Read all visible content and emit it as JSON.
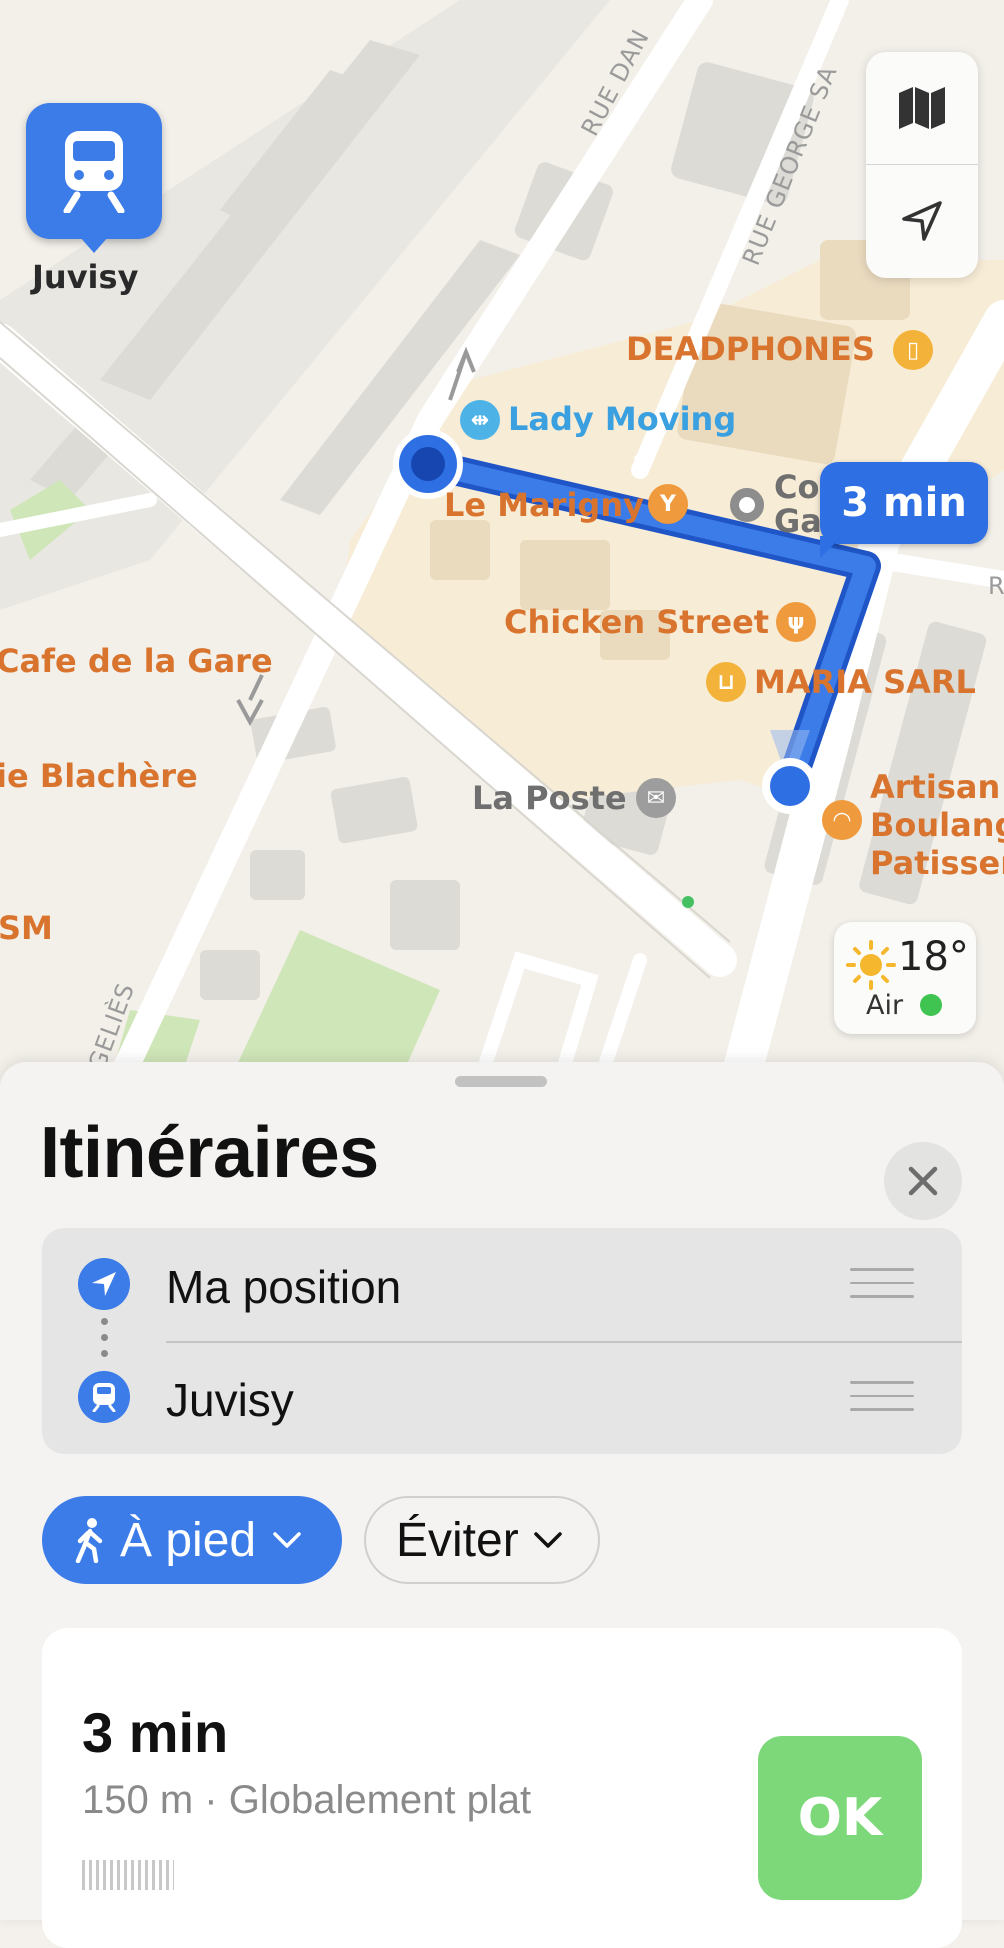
{
  "map": {
    "station": {
      "name": "Juvisy"
    },
    "route_time": "3 min",
    "streets": [
      "RUE DAN",
      "RUE GEORGE SA",
      "GELIÈS",
      "R"
    ],
    "pois": [
      {
        "name": "DEADPHONES",
        "icon": "phone-icon"
      },
      {
        "name": "Lady Moving",
        "icon": "dumbbell-icon"
      },
      {
        "name": "Le Marigny",
        "icon": "cocktail-icon"
      },
      {
        "name": "Co",
        "name2": "Ga",
        "icon": "circle-icon"
      },
      {
        "name": "Chicken Street",
        "icon": "fork-knife-icon"
      },
      {
        "name": "MARIA SARL",
        "icon": "cart-icon"
      },
      {
        "name": "La Poste",
        "icon": "envelope-icon"
      },
      {
        "name": "Artisan",
        "name2": "Boulang",
        "name3": "Patisser",
        "icon": "croissant-icon"
      },
      {
        "name": "Cafe de la Gare"
      },
      {
        "name": "ie Blachère"
      },
      {
        "name": "SM"
      }
    ],
    "weather": {
      "temp": "18°",
      "air_label": "Air",
      "icon": "sun-icon",
      "air_color": "#3fc351"
    },
    "controls": [
      "map-mode-icon",
      "location-arrow-icon"
    ]
  },
  "sheet": {
    "title": "Itinéraires",
    "waypoints": [
      {
        "label": "Ma position",
        "icon": "location-arrow-icon"
      },
      {
        "label": "Juvisy",
        "icon": "train-icon"
      }
    ],
    "mode": {
      "label": "À pied",
      "icon": "walking-icon"
    },
    "avoid": {
      "label": "Éviter"
    },
    "route": {
      "time": "3 min",
      "detail": "150 m · Globalement plat",
      "go_label": "OK"
    }
  },
  "colors": {
    "accent": "#3b7ce8",
    "route": "#2f6fe4",
    "go": "#7dd87a",
    "poi": "#d9742f"
  }
}
